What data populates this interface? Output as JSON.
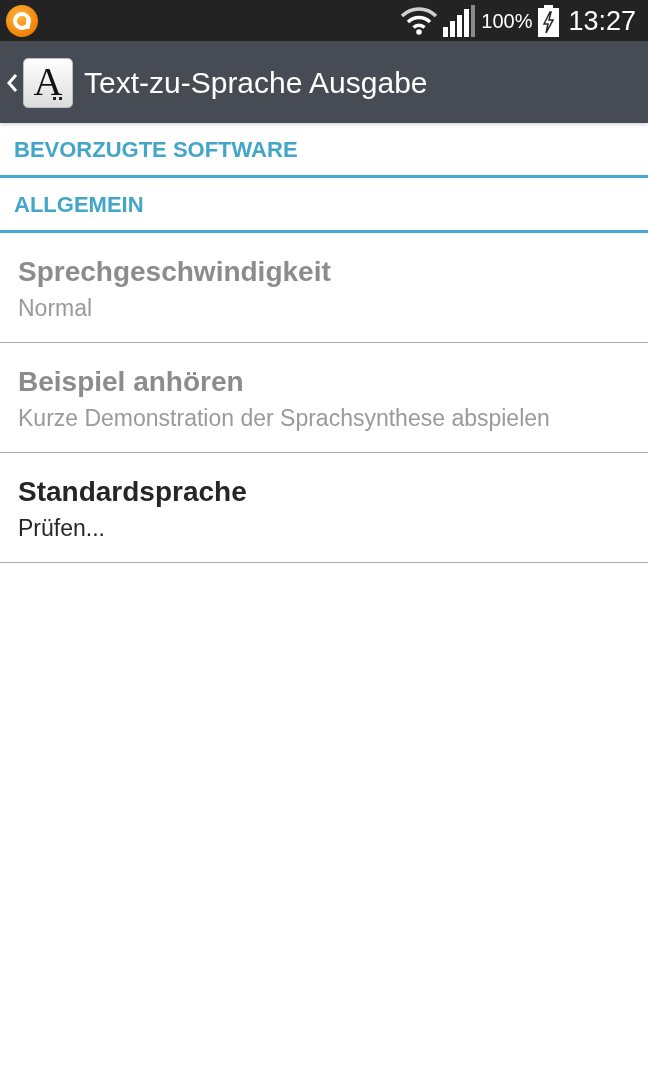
{
  "status_bar": {
    "battery": "100%",
    "time": "13:27"
  },
  "action_bar": {
    "logo_letter": "A",
    "title": "Text-zu-Sprache Ausgabe"
  },
  "sections": [
    {
      "header": "BEVORZUGTE SOFTWARE"
    },
    {
      "header": "ALLGEMEIN",
      "items": [
        {
          "title": "Sprechgeschwindigkeit",
          "summary": "Normal",
          "disabled": true
        },
        {
          "title": "Beispiel anhören",
          "summary": "Kurze Demonstration der Sprachsynthese abspielen",
          "disabled": true
        },
        {
          "title": "Standardsprache",
          "summary": "Prüfen...",
          "disabled": false
        }
      ]
    }
  ]
}
